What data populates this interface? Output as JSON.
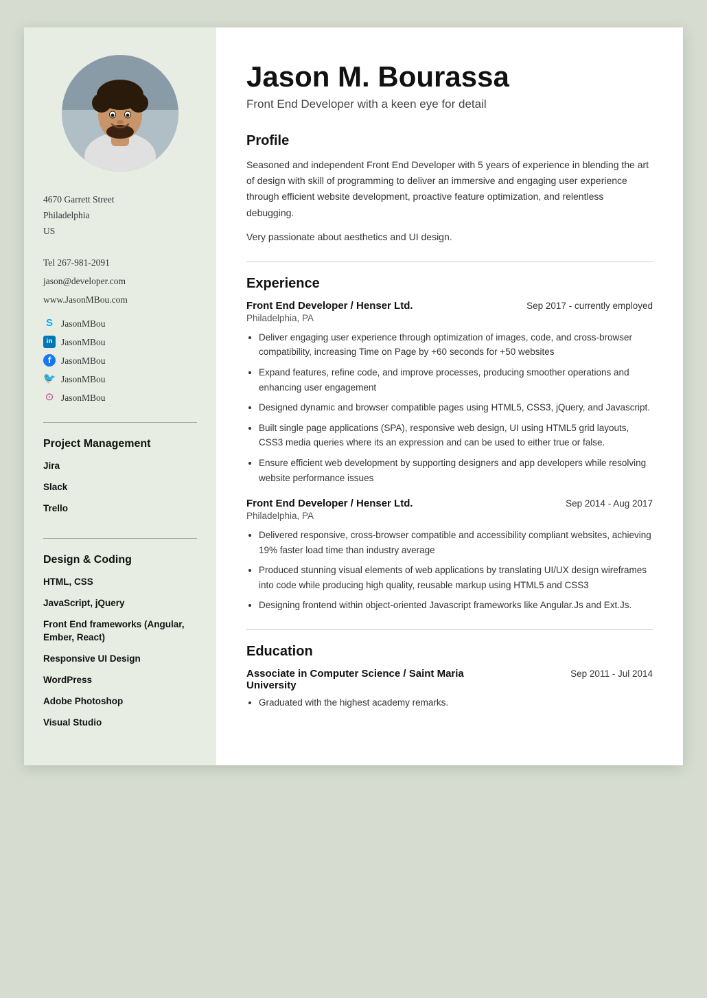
{
  "sidebar": {
    "address": {
      "street": "4670 Garrett Street",
      "city": "Philadelphia",
      "country": "US"
    },
    "contact": {
      "tel": "Tel 267-981-2091",
      "email": "jason@developer.com",
      "website": "www.JasonMBou.com"
    },
    "socials": [
      {
        "name": "Skype",
        "icon": "S",
        "handle": "JasonMBou",
        "color": "#00aff0"
      },
      {
        "name": "LinkedIn",
        "icon": "in",
        "handle": "JasonMBou",
        "color": "#0077b5"
      },
      {
        "name": "Facebook",
        "icon": "f",
        "handle": "JasonMBou",
        "color": "#1877f2"
      },
      {
        "name": "Twitter",
        "icon": "🐦",
        "handle": "JasonMBou",
        "color": "#1da1f2"
      },
      {
        "name": "Instagram",
        "icon": "⊙",
        "handle": "JasonMBou",
        "color": "#c13584"
      }
    ],
    "sections": [
      {
        "title": "Project Management",
        "items": [
          "Jira",
          "Slack",
          "Trello"
        ]
      },
      {
        "title": "Design & Coding",
        "items": [
          "HTML, CSS",
          "JavaScript, jQuery",
          "Front End frameworks (Angular, Ember, React)",
          "Responsive UI Design",
          "WordPress",
          "Adobe Photoshop",
          "Visual Studio"
        ]
      }
    ]
  },
  "main": {
    "name": "Jason M. Bourassa",
    "tagline": "Front End Developer with a keen eye for detail",
    "sections": [
      {
        "type": "profile",
        "title": "Profile",
        "paragraphs": [
          "Seasoned and independent Front End Developer with 5 years of experience in blending the art of design with skill of programming to deliver an immersive and engaging user experience through efficient website development, proactive feature optimization, and relentless debugging.",
          "Very passionate about aesthetics and UI design."
        ]
      },
      {
        "type": "experience",
        "title": "Experience",
        "jobs": [
          {
            "title": "Front End Developer  /  Henser Ltd.",
            "date": "Sep 2017 - currently employed",
            "location": "Philadelphia, PA",
            "bullets": [
              "Deliver engaging user experience through optimization of images, code, and cross-browser compatibility, increasing Time on Page by +60 seconds for +50 websites",
              "Expand features, refine code, and improve processes, producing smoother operations and enhancing user engagement",
              "Designed dynamic and browser compatible pages using HTML5, CSS3, jQuery, and Javascript.",
              "Built single page applications (SPA), responsive web design, UI using HTML5 grid layouts, CSS3 media queries where its an expression and can be used to either true or false.",
              "Ensure efficient web development by supporting designers and app developers while resolving website performance issues"
            ]
          },
          {
            "title": "Front End Developer  /  Henser Ltd.",
            "date": "Sep 2014 - Aug 2017",
            "location": "Philadelphia, PA",
            "bullets": [
              "Delivered responsive, cross-browser compatible and accessibility compliant websites, achieving 19% faster load time than industry average",
              "Produced stunning visual elements of web applications by translating UI/UX design wireframes into code while producing high quality, reusable markup using HTML5 and CSS3",
              "Designing frontend within object-oriented Javascript frameworks like Angular.Js and Ext.Js."
            ]
          }
        ]
      },
      {
        "type": "education",
        "title": "Education",
        "entries": [
          {
            "title": "Associate in Computer Science  /  Saint Maria University",
            "date": "Sep 2011 - Jul 2014",
            "bullets": [
              "Graduated with the highest academy remarks."
            ]
          }
        ]
      }
    ]
  }
}
